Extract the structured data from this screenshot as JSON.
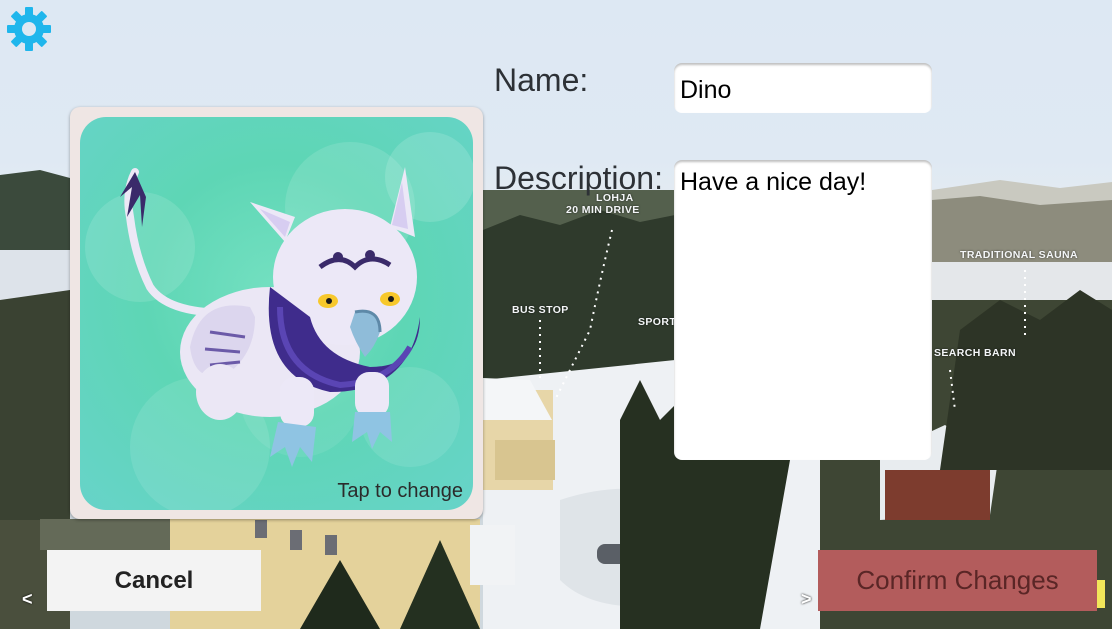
{
  "form": {
    "name_label": "Name:",
    "name_value": "Dino",
    "description_label": "Description:",
    "description_value": "Have a nice day!"
  },
  "avatar": {
    "tap_label": "Tap to change",
    "creature": "griffin"
  },
  "buttons": {
    "cancel_label": "Cancel",
    "confirm_label": "Confirm Changes",
    "prev_arrow": "<",
    "next_arrow": ">"
  },
  "map_labels": {
    "lohja_line1": "LOHJA",
    "lohja_line2": "20 MIN DRIVE",
    "bus_stop": "BUS STOP",
    "sport": "SPORT",
    "traditional_sauna": "TRADITIONAL SAUNA",
    "research_barn": "SEARCH BARN"
  },
  "colors": {
    "gear": "#1fb6ec",
    "confirm_bg": "#b35c5c",
    "confirm_text": "#5a2626",
    "cancel_bg": "#f3f3f3"
  },
  "icons": {
    "settings": "gear-icon"
  }
}
